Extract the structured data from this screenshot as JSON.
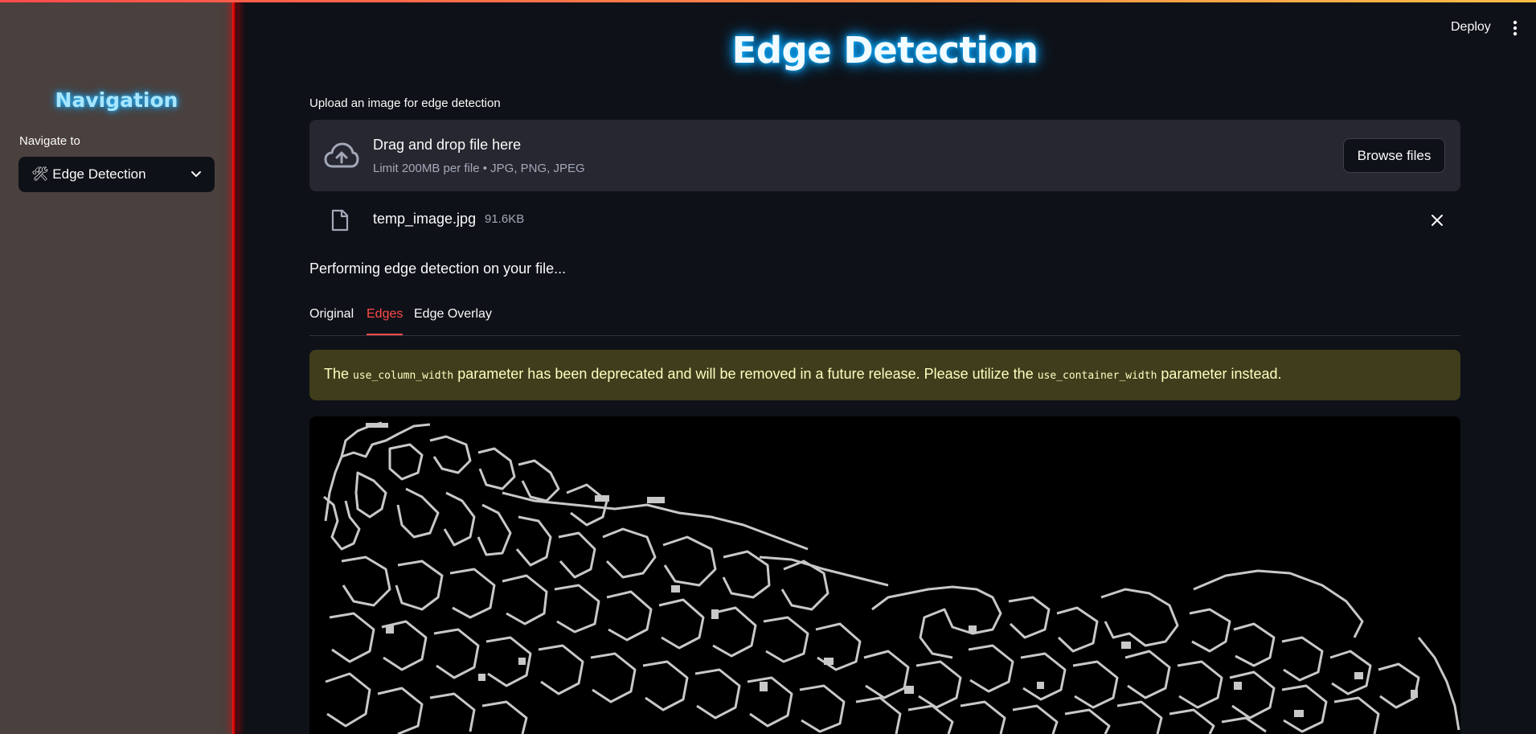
{
  "sidebar": {
    "title": "Navigation",
    "nav_label": "Navigate to",
    "selected": "🛠 Edge Detection"
  },
  "header": {
    "deploy_label": "Deploy"
  },
  "main": {
    "title": "Edge Detection",
    "upload_label": "Upload an image for edge detection",
    "dropzone": {
      "title": "Drag and drop file here",
      "subtitle": "Limit 200MB per file • JPG, PNG, JPEG",
      "browse_label": "Browse files"
    },
    "file": {
      "name": "temp_image.jpg",
      "size": "91.6KB"
    },
    "status": "Performing edge detection on your file...",
    "tabs": [
      {
        "label": "Original",
        "active": false
      },
      {
        "label": "Edges",
        "active": true
      },
      {
        "label": "Edge Overlay",
        "active": false
      }
    ],
    "warning": {
      "part1": "The ",
      "code1": "use_column_width",
      "part2": " parameter has been deprecated and will be removed in a future release. Please utilize the ",
      "code2": "use_container_width",
      "part3": " parameter instead."
    }
  },
  "colors": {
    "accent": "#ff4b4b",
    "sidebar_bg": "#4a403e",
    "main_bg": "#0e1117",
    "warning_bg": "#3f3d1b",
    "title_glow": "#18b4ff"
  }
}
